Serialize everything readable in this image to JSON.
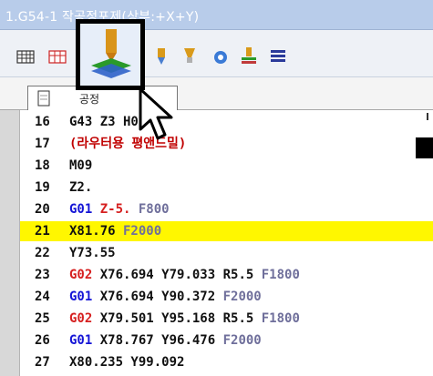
{
  "window": {
    "title": "1.G54-1 작공정포제(상부:+X+Y)"
  },
  "toolbar": {
    "icons": [
      "grid-icon",
      "grid-icon",
      "stacked-tool-icon",
      "drill-tool-icon",
      "end-mill-icon",
      "camera-icon",
      "stacked-tool-icon",
      "list-icon"
    ]
  },
  "tab": {
    "label": "공정"
  },
  "lines": [
    {
      "num": "16",
      "parts": [
        {
          "t": "G43 Z3",
          "c": "#111111"
        },
        {
          "t": "   H01",
          "c": "#111111"
        }
      ]
    },
    {
      "num": "17",
      "parts": [
        {
          "t": "(라우터용 평앤드밀)",
          "c": "#c00000"
        }
      ]
    },
    {
      "num": "18",
      "parts": [
        {
          "t": "M09",
          "c": "#111111"
        }
      ]
    },
    {
      "num": "19",
      "parts": [
        {
          "t": "Z2.",
          "c": "#111111"
        }
      ]
    },
    {
      "num": "20",
      "parts": [
        {
          "t": "G01",
          "c": "#1515d6"
        },
        {
          "t": " Z-5.",
          "c": "#d62020"
        },
        {
          "t": " F800",
          "c": "#6f6f9b"
        }
      ]
    },
    {
      "num": "21",
      "highlight": true,
      "parts": [
        {
          "t": "X81.76",
          "c": "#111111"
        },
        {
          "t": " F2000",
          "c": "#6f6f9b"
        }
      ]
    },
    {
      "num": "22",
      "parts": [
        {
          "t": "Y73.55",
          "c": "#111111"
        }
      ]
    },
    {
      "num": "23",
      "parts": [
        {
          "t": "G02",
          "c": "#d62020"
        },
        {
          "t": " X76.694 Y79.033 R5.5",
          "c": "#111111"
        },
        {
          "t": " F1800",
          "c": "#6f6f9b"
        }
      ]
    },
    {
      "num": "24",
      "parts": [
        {
          "t": "G01",
          "c": "#1515d6"
        },
        {
          "t": " X76.694 Y90.372",
          "c": "#111111"
        },
        {
          "t": " F2000",
          "c": "#6f6f9b"
        }
      ]
    },
    {
      "num": "25",
      "parts": [
        {
          "t": "G02",
          "c": "#d62020"
        },
        {
          "t": " X79.501 Y95.168 R5.5",
          "c": "#111111"
        },
        {
          "t": " F1800",
          "c": "#6f6f9b"
        }
      ]
    },
    {
      "num": "26",
      "parts": [
        {
          "t": "G01",
          "c": "#1515d6"
        },
        {
          "t": " X78.767 Y96.476",
          "c": "#111111"
        },
        {
          "t": " F2000",
          "c": "#6f6f9b"
        }
      ]
    },
    {
      "num": "27",
      "parts": [
        {
          "t": "X80.235 Y99.092",
          "c": "#111111"
        }
      ]
    }
  ],
  "colors": {
    "highlight": "#fff700",
    "gutter": "#d8d8d8",
    "title_bar": "#b8ccea"
  }
}
